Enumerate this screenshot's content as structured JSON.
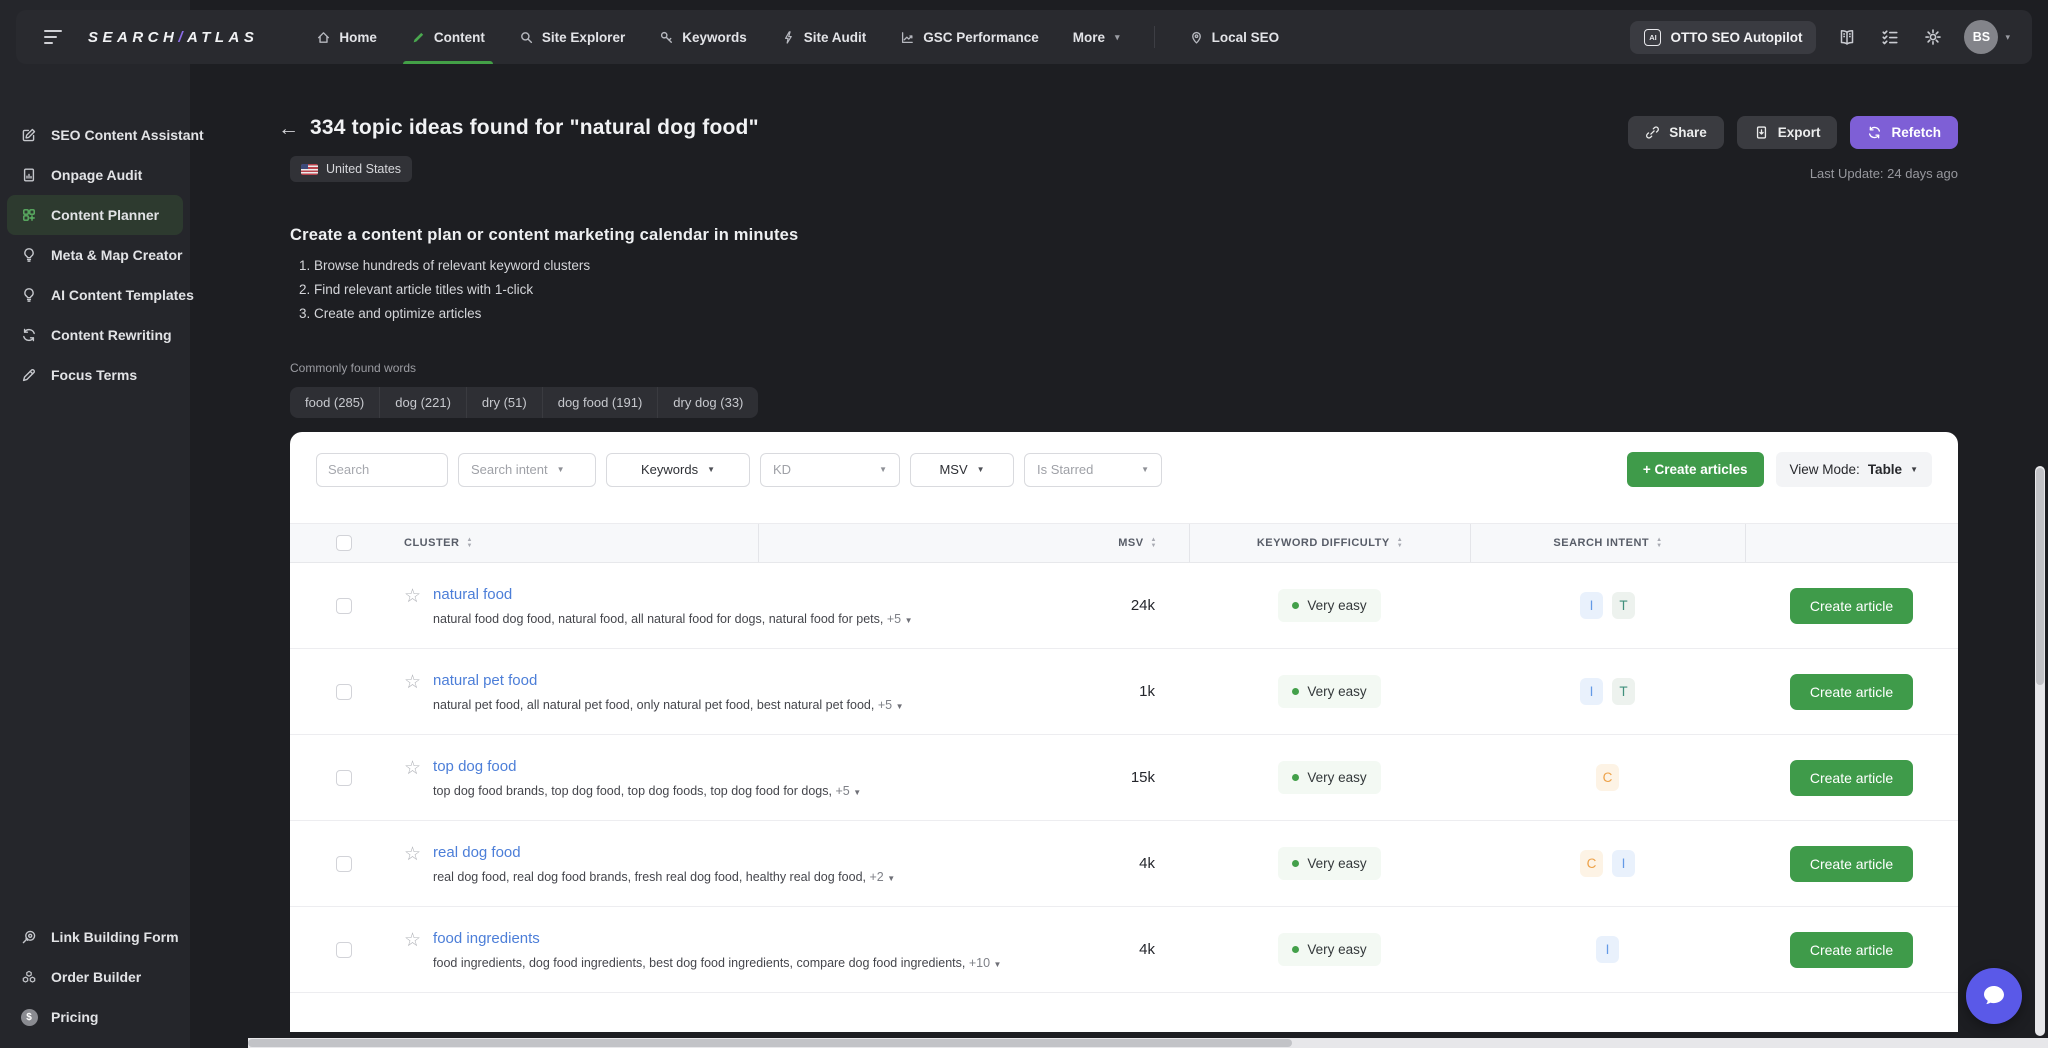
{
  "nav": {
    "logo": {
      "left": "SEARCH",
      "slash": "/",
      "right": "ATLAS"
    },
    "items": [
      {
        "label": "Home"
      },
      {
        "label": "Content"
      },
      {
        "label": "Site Explorer"
      },
      {
        "label": "Keywords"
      },
      {
        "label": "Site Audit"
      },
      {
        "label": "GSC Performance"
      },
      {
        "label": "More"
      },
      {
        "label": "Local SEO"
      }
    ],
    "more_caret": "▾",
    "otto_label": "OTTO SEO Autopilot",
    "otto_chip": "AI",
    "avatar_initials": "BS",
    "avatar_caret": "▾"
  },
  "sidebar": {
    "items": [
      {
        "label": "SEO Content Assistant"
      },
      {
        "label": "Onpage Audit"
      },
      {
        "label": "Content Planner"
      },
      {
        "label": "Meta & Map Creator"
      },
      {
        "label": "AI Content Templates"
      },
      {
        "label": "Content Rewriting"
      },
      {
        "label": "Focus Terms"
      }
    ],
    "footer_items": [
      {
        "label": "Link Building Form"
      },
      {
        "label": "Order Builder"
      },
      {
        "label": "Pricing"
      }
    ]
  },
  "header": {
    "back": "←",
    "title": "334 topic ideas found for \"natural dog food\"",
    "country": "United States",
    "share_label": "Share",
    "export_label": "Export",
    "refetch_label": "Refetch",
    "last_update": "Last Update: 24 days ago"
  },
  "intro": {
    "heading": "Create a content plan or content marketing calendar in minutes",
    "steps": [
      "Browse hundreds of relevant keyword clusters",
      "Find relevant article titles with 1-click",
      "Create and optimize articles"
    ],
    "common_words_label": "Commonly found words",
    "word_chips": [
      "food (285)",
      "dog (221)",
      "dry (51)",
      "dog food (191)",
      "dry dog (33)"
    ]
  },
  "filters": {
    "search_placeholder": "Search",
    "search_intent": "Search intent",
    "keywords": "Keywords",
    "kd": "KD",
    "msv": "MSV",
    "is_starred": "Is Starred",
    "caret": "▼"
  },
  "toolbar": {
    "create_articles": "+ Create articles",
    "view_mode_label": "View Mode:",
    "view_mode_value": "Table",
    "caret": "▼"
  },
  "table": {
    "columns": [
      "CLUSTER",
      "MSV",
      "KEYWORD DIFFICULTY",
      "SEARCH INTENT"
    ],
    "create_article_label": "Create article",
    "rows": [
      {
        "cluster": "natural food",
        "keywords": "natural food dog food, natural food, all natural food for dogs, natural food for pets,",
        "more": "+5",
        "msv": "24k",
        "difficulty": "Very easy",
        "intents": [
          {
            "letter": "I",
            "kind": "informational"
          },
          {
            "letter": "T",
            "kind": "transactional"
          }
        ]
      },
      {
        "cluster": "natural pet food",
        "keywords": "natural pet food, all natural pet food, only natural pet food, best natural pet food,",
        "more": "+5",
        "msv": "1k",
        "difficulty": "Very easy",
        "intents": [
          {
            "letter": "I",
            "kind": "informational"
          },
          {
            "letter": "T",
            "kind": "transactional"
          }
        ]
      },
      {
        "cluster": "top dog food",
        "keywords": "top dog food brands, top dog food, top dog foods, top dog food for dogs,",
        "more": "+5",
        "msv": "15k",
        "difficulty": "Very easy",
        "intents": [
          {
            "letter": "C",
            "kind": "commercial"
          }
        ]
      },
      {
        "cluster": "real dog food",
        "keywords": "real dog food, real dog food brands, fresh real dog food, healthy real dog food,",
        "more": "+2",
        "msv": "4k",
        "difficulty": "Very easy",
        "intents": [
          {
            "letter": "C",
            "kind": "commercial"
          },
          {
            "letter": "I",
            "kind": "informational"
          }
        ]
      },
      {
        "cluster": "food ingredients",
        "keywords": "food ingredients, dog food ingredients, best dog food ingredients, compare dog food ingredients,",
        "more": "+10",
        "msv": "4k",
        "difficulty": "Very easy",
        "intents": [
          {
            "letter": "I",
            "kind": "informational"
          }
        ]
      }
    ]
  },
  "colors": {
    "accent_green": "#3f9b4a",
    "refetch_purple": "#7e5fd6",
    "cluster_link_blue": "#4c7ed8",
    "intent_informational": "#639ae6",
    "intent_transactional": "#40907c",
    "intent_commercial": "#eda148",
    "chat_fab": "#5a59e8",
    "very_easy_dot": "#43a04a"
  }
}
